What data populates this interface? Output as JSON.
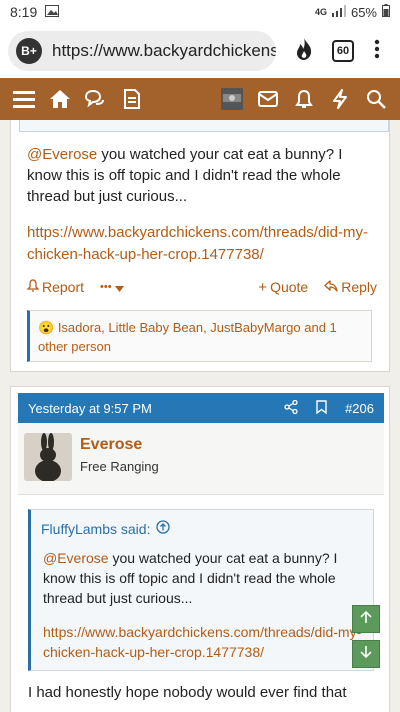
{
  "status_bar": {
    "time": "8:19",
    "network": "4G",
    "battery": "65%"
  },
  "browser": {
    "url": "https://www.backyardchickens",
    "tab_count": "60",
    "badge": "B+"
  },
  "post_top": {
    "mention": "@Everose",
    "text": " you watched your cat eat a bunny? I know this is off topic and I didn't read the whole thread but just curious...",
    "link": "https://www.backyardchickens.com/threads/did-my-chicken-hack-up-her-crop.1477738/",
    "actions": {
      "report": "Report",
      "more": "•••",
      "quote": "Quote",
      "reply": "Reply"
    },
    "reactions": {
      "emoji": "😮",
      "text": "Isadora, Little Baby Bean, JustBabyMargo and 1 other person"
    }
  },
  "post_206": {
    "timestamp": "Yesterday at 9:57 PM",
    "number": "#206",
    "author": {
      "name": "Everose",
      "title": "Free Ranging"
    },
    "quote": {
      "author_line": "FluffyLambs said:",
      "mention": "@Everose",
      "text": " you watched your cat eat a bunny? I know this is off topic and I didn't read the whole thread but just curious...",
      "link": "https://www.backyardchickens.com/threads/did-my-chicken-hack-up-her-crop.1477738/"
    },
    "body": "I had honestly hope nobody would ever find that"
  },
  "colors": {
    "nav_bar": "#a3622b",
    "post_header": "#2577b5",
    "link": "#b35c15",
    "scroll_buttons": "#5b9a5b"
  },
  "icons": [
    "menu-icon",
    "home-icon",
    "chat-icon",
    "document-icon",
    "user-avatar",
    "mail-icon",
    "bell-icon",
    "bolt-icon",
    "search-icon",
    "share-icon",
    "bookmark-icon",
    "flame-icon",
    "kebab-icon",
    "arrow-up-icon",
    "arrow-down-icon"
  ]
}
